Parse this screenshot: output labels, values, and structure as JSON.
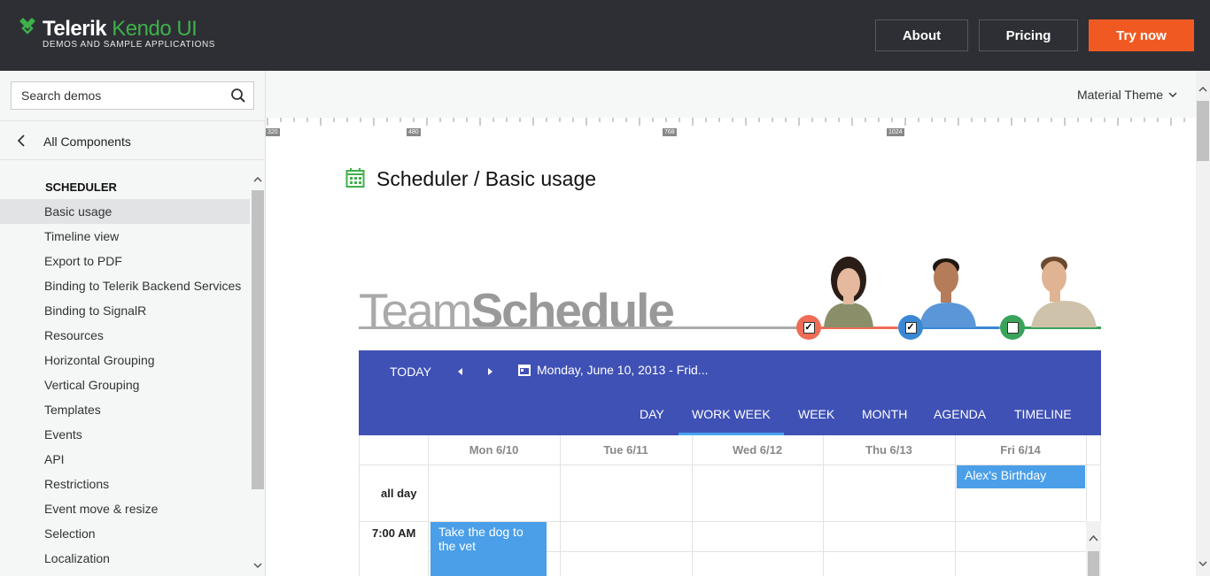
{
  "header": {
    "logo_brand": "Telerik",
    "logo_product": "Kendo UI",
    "logo_sub": "DEMOS AND SAMPLE APPLICATIONS",
    "about_label": "About",
    "pricing_label": "Pricing",
    "try_label": "Try now",
    "accent_color": "#f05a22",
    "bg_color": "#2d2f34"
  },
  "sidebar": {
    "search_placeholder": "Search demos",
    "all_components_label": "All Components",
    "section_title": "SCHEDULER",
    "items": [
      {
        "label": "Basic usage",
        "active": true
      },
      {
        "label": "Timeline view"
      },
      {
        "label": "Export to PDF"
      },
      {
        "label": "Binding to Telerik Backend Services"
      },
      {
        "label": "Binding to SignalR"
      },
      {
        "label": "Resources"
      },
      {
        "label": "Horizontal Grouping"
      },
      {
        "label": "Vertical Grouping"
      },
      {
        "label": "Templates"
      },
      {
        "label": "Events"
      },
      {
        "label": "API"
      },
      {
        "label": "Restrictions"
      },
      {
        "label": "Event move & resize"
      },
      {
        "label": "Selection"
      },
      {
        "label": "Localization"
      }
    ]
  },
  "main": {
    "theme_label": "Material Theme",
    "ruler_labels": [
      "320",
      "480",
      "768",
      "1024"
    ],
    "page_title": "Scheduler / Basic usage"
  },
  "scheduler": {
    "team_word_light": "Team",
    "team_word_bold": "Schedule",
    "people_colors": [
      "#ef6c57",
      "#3a88d4",
      "#3aa35b"
    ],
    "people_checked": [
      true,
      true,
      false
    ],
    "today_label": "TODAY",
    "date_range": "Monday, June 10, 2013 - Frid...",
    "views": [
      "DAY",
      "WORK WEEK",
      "WEEK",
      "MONTH",
      "AGENDA",
      "TIMELINE"
    ],
    "selected_view": "WORK WEEK",
    "toolbar_color": "#3f51b5",
    "days": [
      "Mon 6/10",
      "Tue 6/11",
      "Wed 6/12",
      "Thu 6/13",
      "Fri 6/14"
    ],
    "all_day_label": "all day",
    "time_label": "7:00 AM",
    "events": {
      "all_day": "Alex's Birthday",
      "timed": "Take the dog to the vet"
    }
  }
}
